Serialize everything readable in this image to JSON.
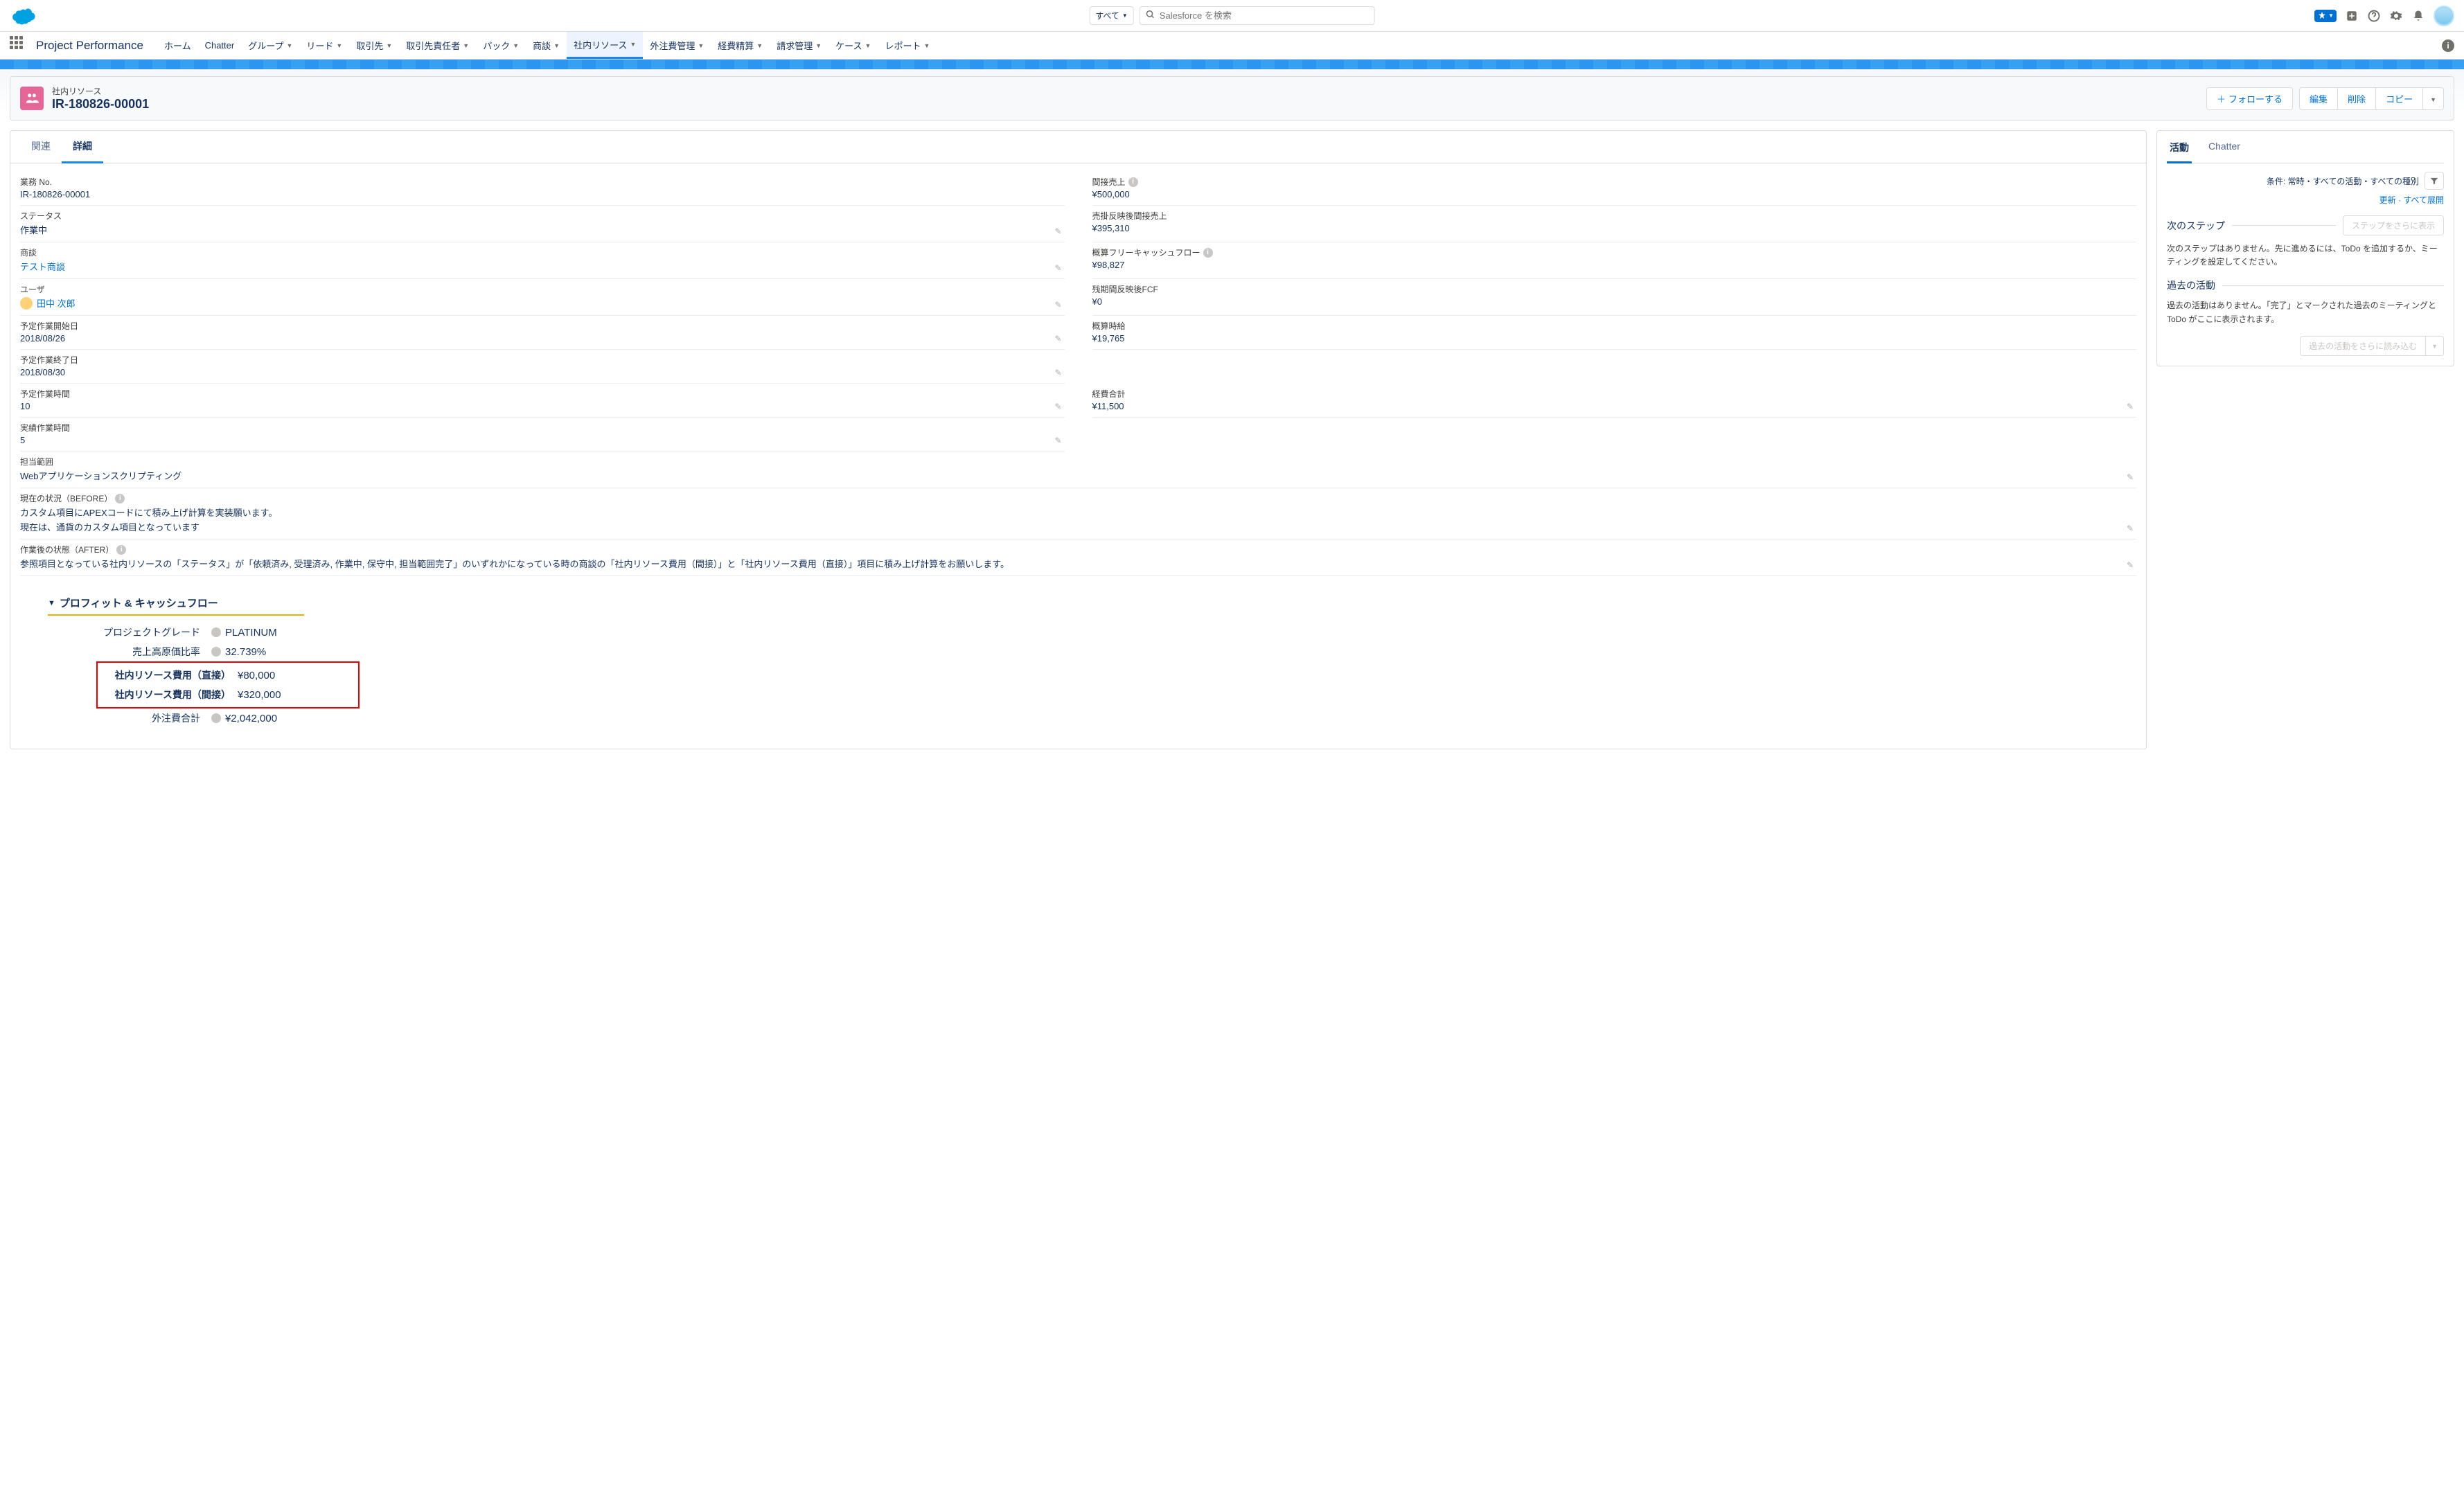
{
  "header": {
    "scope": "すべて",
    "search_placeholder": "Salesforce を検索"
  },
  "nav": {
    "app_name": "Project Performance",
    "items": [
      "ホーム",
      "Chatter",
      "グループ",
      "リード",
      "取引先",
      "取引先責任者",
      "パック",
      "商談",
      "社内リソース",
      "外注費管理",
      "経費精算",
      "請求管理",
      "ケース",
      "レポート"
    ]
  },
  "record": {
    "object_label": "社内リソース",
    "title": "IR-180826-00001",
    "actions": {
      "follow": "フォローする",
      "edit": "編集",
      "delete": "削除",
      "copy": "コピー"
    }
  },
  "tabs": {
    "related": "関連",
    "detail": "詳細"
  },
  "fields": {
    "biz_no_label": "業務 No.",
    "biz_no": "IR-180826-00001",
    "status_label": "ステータス",
    "status": "作業中",
    "opp_label": "商談",
    "opp": "テスト商談",
    "user_label": "ユーザ",
    "user": "田中 次郎",
    "start_label": "予定作業開始日",
    "start": "2018/08/26",
    "end_label": "予定作業終了日",
    "end": "2018/08/30",
    "plan_h_label": "予定作業時間",
    "plan_h": "10",
    "actual_h_label": "実績作業時間",
    "actual_h": "5",
    "scope_label": "担当範囲",
    "scope": "Webアプリケーションスクリプティング",
    "indirect_sales_label": "間接売上",
    "indirect_sales": "¥500,000",
    "ar_indirect_label": "売掛反映後間接売上",
    "ar_indirect": "¥395,310",
    "fcf_label": "概算フリーキャッシュフロー",
    "fcf": "¥98,827",
    "rem_fcf_label": "残期間反映後FCF",
    "rem_fcf": "¥0",
    "hourly_label": "概算時給",
    "hourly": "¥19,765",
    "exp_total_label": "経費合計",
    "exp_total": "¥11,500",
    "before_label": "現在の状況（BEFORE）",
    "before1": "カスタム項目にAPEXコードにて積み上げ計算を実装願います。",
    "before2": "現在は、通貨のカスタム項目となっています",
    "after_label": "作業後の状態（AFTER）",
    "after": "参照項目となっている社内リソースの「ステータス」が「依頼済み, 受理済み, 作業中, 保守中, 担当範囲完了」のいずれかになっている時の商談の「社内リソース費用（間接）」と「社内リソース費用（直接）」項目に積み上げ計算をお願いします。"
  },
  "profit": {
    "title": "プロフィット & キャッシュフロー",
    "grade_label": "プロジェクトグレード",
    "grade": "PLATINUM",
    "cost_ratio_label": "売上高原価比率",
    "cost_ratio": "32.739%",
    "direct_label": "社内リソース費用（直接）",
    "direct": "¥80,000",
    "indirect_label": "社内リソース費用（間接）",
    "indirect": "¥320,000",
    "out_label": "外注費合計",
    "out": "¥2,042,000"
  },
  "activity": {
    "tab_activity": "活動",
    "tab_chatter": "Chatter",
    "filter_text": "条件: 常時・すべての活動・すべての種別",
    "refresh": "更新",
    "expand_all": "すべて展開",
    "next_steps": "次のステップ",
    "show_more_steps": "ステップをさらに表示",
    "next_steps_desc": "次のステップはありません。先に進めるには、ToDo を追加するか、ミーティングを設定してください。",
    "past": "過去の活動",
    "past_desc": "過去の活動はありません。「完了」とマークされた過去のミーティングと ToDo がここに表示されます。",
    "load_past": "過去の活動をさらに読み込む"
  }
}
